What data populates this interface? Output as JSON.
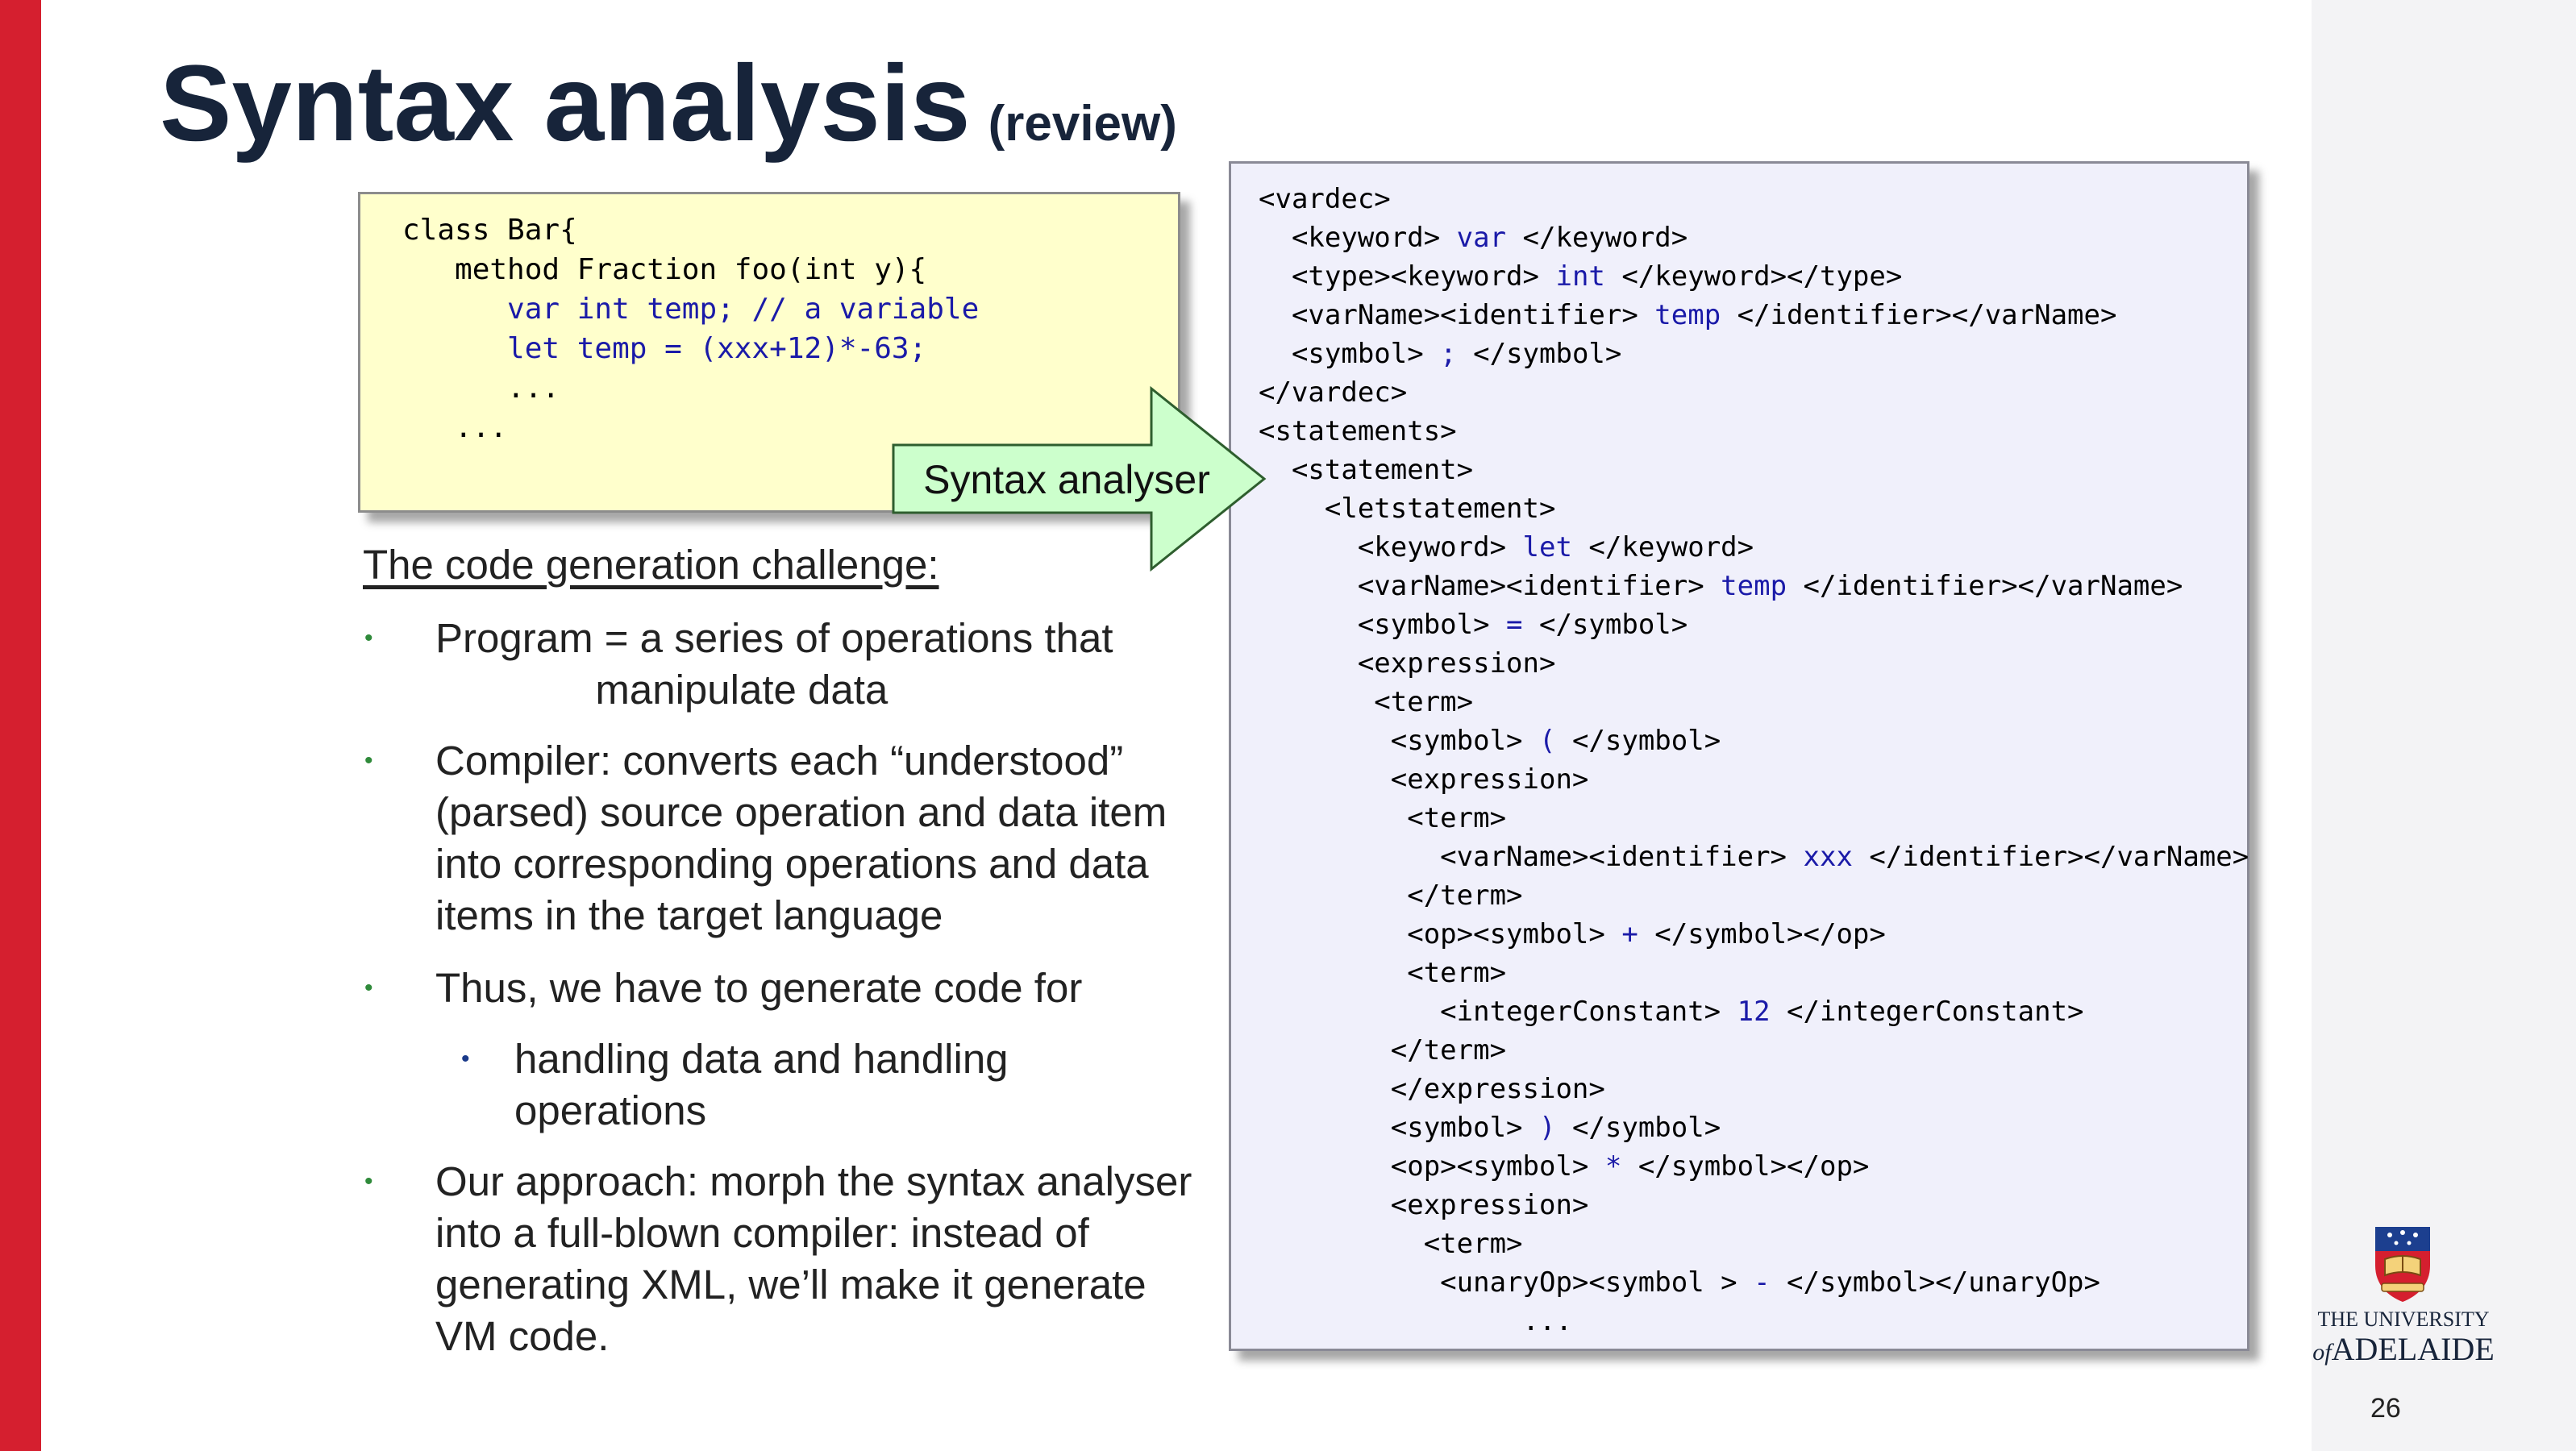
{
  "slide": {
    "title": "Syntax analysis",
    "title_note": "(review)",
    "page_number": "26"
  },
  "source_code": {
    "lines": [
      {
        "text": "class Bar{",
        "color": "black"
      },
      {
        "text": "   method Fraction foo(int y){",
        "color": "black"
      },
      {
        "text": "      var int temp; // a variable",
        "color": "blue"
      },
      {
        "text": "      let temp = (xxx+12)*-63;",
        "color": "blue"
      },
      {
        "text": "      ...",
        "color": "black"
      },
      {
        "text": "   ...",
        "color": "black"
      }
    ]
  },
  "arrow": {
    "label": "Syntax analyser"
  },
  "xml_output": {
    "lines": [
      {
        "pre": "<vardec>",
        "val": "",
        "post": ""
      },
      {
        "pre": "  <keyword> ",
        "val": "var",
        "post": " </keyword>"
      },
      {
        "pre": "  <type><keyword> ",
        "val": "int",
        "post": " </keyword></type>"
      },
      {
        "pre": "  <varName><identifier> ",
        "val": "temp",
        "post": " </identifier></varName>"
      },
      {
        "pre": "  <symbol> ",
        "val": ";",
        "post": " </symbol>"
      },
      {
        "pre": "</vardec>",
        "val": "",
        "post": ""
      },
      {
        "pre": "<statements>",
        "val": "",
        "post": ""
      },
      {
        "pre": "  <statement>",
        "val": "",
        "post": ""
      },
      {
        "pre": "    <letstatement>",
        "val": "",
        "post": ""
      },
      {
        "pre": "      <keyword> ",
        "val": "let",
        "post": " </keyword>"
      },
      {
        "pre": "      <varName><identifier> ",
        "val": "temp",
        "post": " </identifier></varName>"
      },
      {
        "pre": "      <symbol> ",
        "val": "=",
        "post": " </symbol>"
      },
      {
        "pre": "      <expression>",
        "val": "",
        "post": ""
      },
      {
        "pre": "       <term>",
        "val": "",
        "post": ""
      },
      {
        "pre": "        <symbol> ",
        "val": "(",
        "post": " </symbol>"
      },
      {
        "pre": "        <expression>",
        "val": "",
        "post": ""
      },
      {
        "pre": "         <term>",
        "val": "",
        "post": ""
      },
      {
        "pre": "           <varName><identifier> ",
        "val": "xxx",
        "post": " </identifier></varName>"
      },
      {
        "pre": "         </term>",
        "val": "",
        "post": ""
      },
      {
        "pre": "         <op><symbol> ",
        "val": "+",
        "post": " </symbol></op>"
      },
      {
        "pre": "         <term>",
        "val": "",
        "post": ""
      },
      {
        "pre": "           <integerConstant> ",
        "val": "12",
        "post": " </integerConstant>"
      },
      {
        "pre": "        </term>",
        "val": "",
        "post": ""
      },
      {
        "pre": "        </expression>",
        "val": "",
        "post": ""
      },
      {
        "pre": "        <symbol> ",
        "val": ")",
        "post": " </symbol>"
      },
      {
        "pre": "        <op><symbol> ",
        "val": "*",
        "post": " </symbol></op>"
      },
      {
        "pre": "        <expression>",
        "val": "",
        "post": ""
      },
      {
        "pre": "          <term>",
        "val": "",
        "post": ""
      },
      {
        "pre": "           <unaryOp><symbol > ",
        "val": "-",
        "post": " </symbol></unaryOp>"
      },
      {
        "pre": "                ...",
        "val": "",
        "post": ""
      }
    ]
  },
  "challenge": {
    "heading": "The code generation challenge:",
    "bullets": [
      "Program = a series of operations that\n              manipulate data",
      "Compiler: converts each “understood”\n(parsed) source operation and data item\ninto corresponding operations and data\nitems in the target language",
      "Thus, we have to generate code for"
    ],
    "sub_bullet": "handling data and handling\noperations",
    "last_bullet": "Our approach: morph the syntax analyser\ninto a full-blown compiler: instead of\ngenerating XML, we’ll make it generate\nVM code."
  },
  "logo": {
    "line1": "THE UNIVERSITY",
    "line2_of": "of",
    "line2": "ADELAIDE"
  },
  "colors": {
    "accent_red": "#d51f2f",
    "title_navy": "#17243a",
    "code_blue": "#1a1aa8",
    "code_box_bg": "#ffffcc",
    "xml_box_bg": "#f0f0fb",
    "arrow_fill": "#ccffcc"
  }
}
